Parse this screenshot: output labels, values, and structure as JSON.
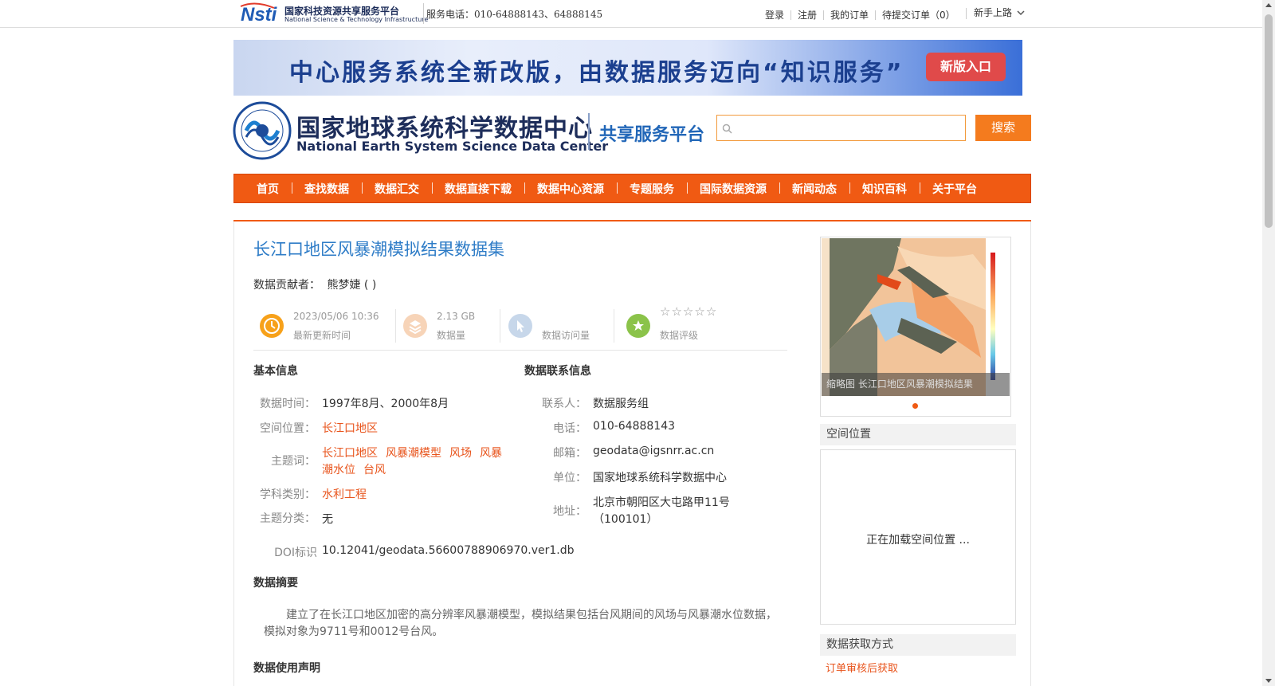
{
  "topbar": {
    "logo_cn": "国家科技资源共享服务平台",
    "logo_en": "National Science & Technology Infrastructure",
    "service_phone": "服务电话：010-64888143、64888145",
    "links": [
      "登录",
      "注册",
      "我的订单",
      "待提交订单（0）"
    ],
    "newbie": "新手上路"
  },
  "banner": {
    "text": "中心服务系统全新改版，由数据服务迈向“知识服务”",
    "button": "新版入口"
  },
  "header": {
    "title_cn": "国家地球系统科学数据中心",
    "title_en": "National Earth System Science Data Center",
    "platform": "共享服务平台",
    "search_placeholder": "",
    "search_button": "搜索"
  },
  "nav": [
    "首页",
    "查找数据",
    "数据汇交",
    "数据直接下载",
    "数据中心资源",
    "专题服务",
    "国际数据资源",
    "新闻动态",
    "知识百科",
    "关于平台"
  ],
  "dataset": {
    "title": "长江口地区风暴潮模拟结果数据集",
    "contributor_label": "数据贡献者：",
    "contributor": "熊梦婕 (  )",
    "stats": {
      "update_time": "2023/05/06 10:36",
      "update_label": "最新更新时间",
      "size": "2.13 GB",
      "size_label": "数据量",
      "visits": "",
      "visits_label": "数据访问量",
      "rating_label": "数据评级",
      "rating": 0,
      "rating_max": 5
    }
  },
  "basic_info": {
    "heading": "基本信息",
    "time_label": "数据时间：",
    "time": "1997年8月、2000年8月",
    "location_label": "空间位置：",
    "location": "长江口地区",
    "keywords_label": "主题词：",
    "keywords_line1": [
      "长江口地区",
      "风暴潮模型",
      "风场",
      "风暴"
    ],
    "keywords_line2": [
      "潮水位",
      "台风"
    ],
    "discipline_label": "学科类别：",
    "discipline": "水利工程",
    "category_label": "主题分类：",
    "category": "无",
    "doi_label": "DOI标识",
    "doi": "10.12041/geodata.56600788906970.ver1.db"
  },
  "contact_info": {
    "heading": "数据联系信息",
    "contact_label": "联系人：",
    "contact": "数据服务组",
    "phone_label": "电话：",
    "phone": "010-64888143",
    "email_label": "邮箱：",
    "email": "geodata@igsnrr.ac.cn",
    "unit_label": "单位：",
    "unit": "国家地球系统科学数据中心",
    "address_label": "地址：",
    "address_line1": "北京市朝阳区大屯路甲11号",
    "address_line2": "（100101）"
  },
  "abstract": {
    "heading": "数据摘要",
    "text": "建立了在长江口地区加密的高分辨率风暴潮模型，模拟结果包括台风期间的风场与风暴潮水位数据，模拟对象为9711号和0012号台风。"
  },
  "usage": {
    "heading": "数据使用声明"
  },
  "sidebar": {
    "thumb_caption": "缩略图  长江口地区风暴潮模拟结果",
    "spatial_heading": "空间位置",
    "map_loading": "正在加载空间位置 ...",
    "access_heading": "数据获取方式",
    "access_method": "订单审核后获取"
  },
  "colors": {
    "brand_orange": "#f05a13",
    "link_orange": "#e8541c",
    "title_blue": "#2e7cc7",
    "search_border": "#f29a3c"
  }
}
